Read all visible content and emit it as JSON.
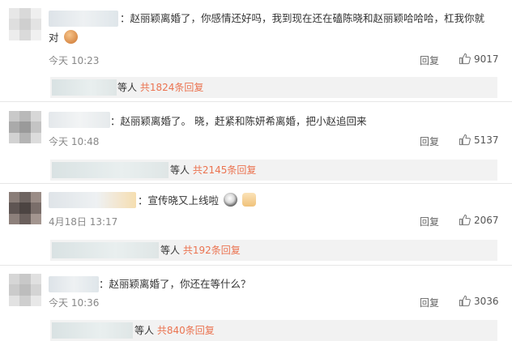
{
  "comments": [
    {
      "text": "：赵丽颖离婚了，你感情还好吗，我到现在还在磕陈晓和赵丽颖哈哈哈，杠我你就",
      "text2": "对",
      "time": "今天 10:23",
      "reply": "回复",
      "likes": "9017",
      "sub": {
        "prefix": "等人",
        "count": "共1824条回复"
      }
    },
    {
      "text": "：赵丽颖离婚了。 晓，赶紧和陈妍希离婚，把小赵追回来",
      "time": "今天 10:48",
      "reply": "回复",
      "likes": "5137",
      "sub": {
        "prefix": "等人",
        "count": "共2145条回复"
      }
    },
    {
      "text": "宣传晓又上线啦",
      "time": "4月18日 13:17",
      "reply": "回复",
      "likes": "2067",
      "sub": {
        "prefix": "等人",
        "count": "共192条回复"
      }
    },
    {
      "text": "：赵丽颖离婚了，你还在等什么？",
      "time": "今天 10:36",
      "reply": "回复",
      "likes": "3036",
      "sub": {
        "prefix": "等人",
        "count": "共840条回复"
      }
    }
  ],
  "icons": {
    "like": "thumbs-up-icon",
    "emoji": "emoji-icon"
  },
  "colors": {
    "link": "#eb7350",
    "meta": "#888888"
  }
}
